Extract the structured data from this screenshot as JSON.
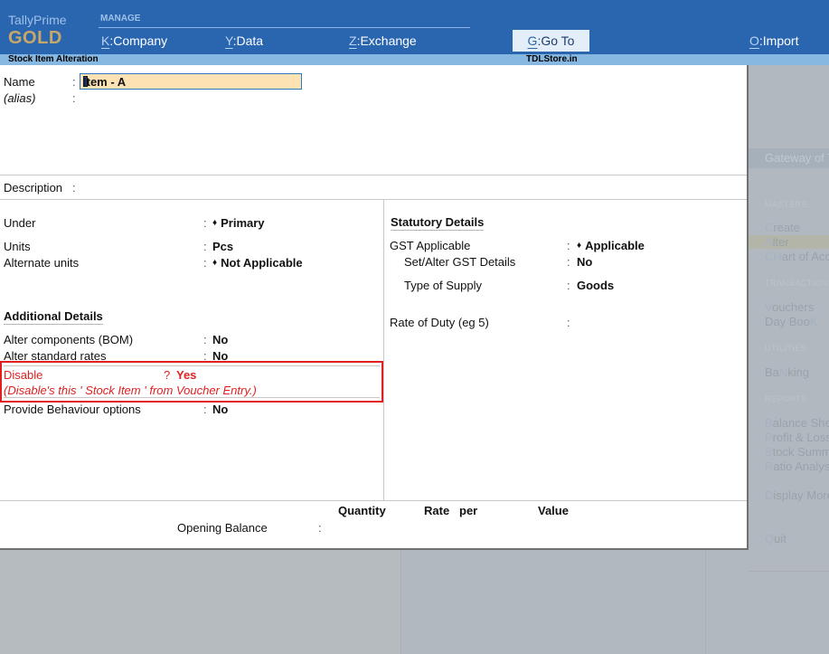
{
  "app": {
    "brand_line1": "TallyPrime",
    "brand_line2": "GOLD"
  },
  "menu": {
    "group_label": "MANAGE",
    "items": [
      {
        "key": "K",
        "label": "Company"
      },
      {
        "key": "Y",
        "label": "Data"
      },
      {
        "key": "Z",
        "label": "Exchange"
      },
      {
        "key": "G",
        "label": "Go To"
      },
      {
        "key": "O",
        "label": "Import"
      }
    ]
  },
  "strip": {
    "title": "Stock Item Alteration",
    "center": "TDLStore.in"
  },
  "form": {
    "name": {
      "label": "Name",
      "value": "Item - A"
    },
    "alias": {
      "label": "(alias)",
      "value": ""
    },
    "description": {
      "label": "Description",
      "value": ""
    },
    "under": {
      "label": "Under",
      "value": "Primary"
    },
    "units": {
      "label": "Units",
      "value": "Pcs"
    },
    "alternate_units": {
      "label": "Alternate units",
      "value": "Not Applicable"
    },
    "additional_details": {
      "heading": "Additional Details",
      "alter_components": {
        "label": "Alter components (BOM)",
        "value": "No"
      },
      "alter_standard_rates": {
        "label": "Alter standard rates",
        "value": "No"
      },
      "disable": {
        "label": "Disable",
        "prompt": "?",
        "value": "Yes",
        "hint": "(Disable's this ' Stock Item ' from Voucher Entry.)"
      },
      "provide_behaviour": {
        "label": "Provide Behaviour options",
        "value": "No"
      }
    },
    "statutory_details": {
      "heading": "Statutory Details",
      "gst_applicable": {
        "label": "GST Applicable",
        "value": "Applicable"
      },
      "set_alter_gst": {
        "label": "Set/Alter GST Details",
        "value": "No"
      },
      "type_of_supply": {
        "label": "Type of Supply",
        "value": "Goods"
      },
      "rate_of_duty": {
        "label": "Rate of Duty (eg 5)",
        "value": ""
      }
    },
    "opening": {
      "col_quantity": "Quantity",
      "col_rate": "Rate",
      "col_per": "per",
      "col_value": "Value",
      "label": "Opening Balance",
      "quantity": "",
      "rate": "",
      "per": "",
      "value": ""
    },
    "separator": ":"
  },
  "gateway": {
    "title": "Gateway of Tally",
    "sections": [
      {
        "label": "MASTERS",
        "items": [
          {
            "hotkey": "C",
            "rest": "reate"
          },
          {
            "hotkey": "A",
            "rest": "lter",
            "selected": true
          },
          {
            "hotkey": "CH",
            "rest": "art of Accounts"
          }
        ]
      },
      {
        "label": "TRANSACTIONS",
        "items": [
          {
            "hotkey": "V",
            "rest": "ouchers"
          },
          {
            "pre": "Day Boo",
            "hotkey": "K",
            "rest": ""
          }
        ]
      },
      {
        "label": "UTILITIES",
        "items": [
          {
            "pre": "Ba",
            "hotkey": "N",
            "rest": "king"
          }
        ]
      },
      {
        "label": "REPORTS",
        "items": [
          {
            "hotkey": "B",
            "rest": "alance Sheet"
          },
          {
            "hotkey": "P",
            "rest": "rofit & Loss A/c"
          },
          {
            "hotkey": "S",
            "rest": "tock Summary"
          },
          {
            "hotkey": "R",
            "rest": "atio Analysis"
          }
        ]
      },
      {
        "label": "",
        "items": [
          {
            "hotkey": "D",
            "rest": "isplay More Reports"
          }
        ]
      },
      {
        "label": "",
        "items": [
          {
            "hotkey": "Q",
            "rest": "uit"
          }
        ]
      }
    ]
  }
}
